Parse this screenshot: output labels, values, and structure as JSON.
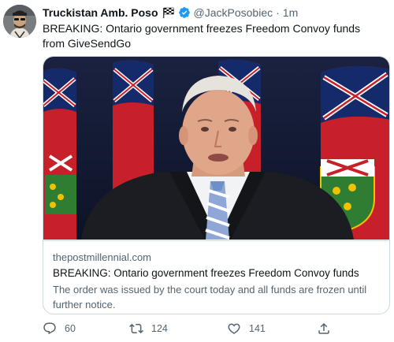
{
  "author": {
    "display_name": "Truckistan Amb. Poso",
    "handle": "@JackPosobiec",
    "separator": "·",
    "time": "1m",
    "flag_icon": "checkered-flag-icon",
    "verified_icon": "verified-badge-icon"
  },
  "tweet": {
    "text": "BREAKING: Ontario government freezes Freedom Convoy funds from GiveSendGo"
  },
  "card": {
    "domain": "thepostmillennial.com",
    "title": "BREAKING: Ontario government freezes Freedom Convoy funds",
    "description": "The order was issued by the court today and all funds are frozen until further notice."
  },
  "actions": {
    "reply_icon": "reply-icon",
    "reply_count": "60",
    "retweet_icon": "retweet-icon",
    "retweet_count": "124",
    "like_icon": "heart-icon",
    "like_count": "141",
    "share_icon": "share-icon"
  },
  "colors": {
    "text_primary": "#0f1419",
    "text_secondary": "#536471",
    "verified_blue": "#1d9bf0",
    "card_border": "#cfd9de"
  }
}
